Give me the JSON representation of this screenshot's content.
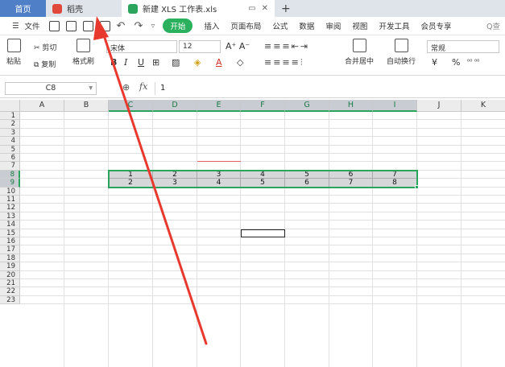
{
  "tabs": {
    "home": "首页",
    "daoke": "稻壳",
    "doc": "新建 XLS 工作表.xls",
    "add": "+"
  },
  "menu": {
    "file": "文件",
    "start": "开始",
    "items": [
      "插入",
      "页面布局",
      "公式",
      "数据",
      "审阅",
      "视图",
      "开发工具",
      "会员专享"
    ],
    "search": "Q查"
  },
  "toolbar": {
    "paste": "粘贴",
    "cut": "剪切",
    "copy": "复制",
    "format_painter": "格式刷",
    "font_name": "宋体",
    "font_size": "12",
    "merge_center": "合并居中",
    "wrap_text": "自动换行",
    "number_format": "常规",
    "currency": "¥",
    "percent": "%"
  },
  "formula": {
    "name_box": "C8",
    "fx": "fx",
    "value": "1"
  },
  "sheet": {
    "columns": [
      "A",
      "B",
      "C",
      "D",
      "E",
      "F",
      "G",
      "H",
      "I",
      "J",
      "K"
    ],
    "selected_columns": [
      "C",
      "D",
      "E",
      "F",
      "G",
      "H",
      "I"
    ],
    "rows": [
      "1",
      "2",
      "3",
      "4",
      "5",
      "6",
      "7",
      "8",
      "9",
      "10",
      "11",
      "12",
      "13",
      "14",
      "15",
      "16",
      "17",
      "18",
      "19",
      "20",
      "21",
      "22",
      "23"
    ],
    "selected_rows": [
      "8",
      "9"
    ],
    "row8": [
      "1",
      "2",
      "3",
      "4",
      "5",
      "6",
      "7"
    ],
    "row9": [
      "2",
      "3",
      "4",
      "5",
      "6",
      "7",
      "8"
    ]
  },
  "colors": {
    "accent_green": "#2aa55b",
    "home_tab": "#4f7fc7",
    "arrow": "#e8392f"
  }
}
